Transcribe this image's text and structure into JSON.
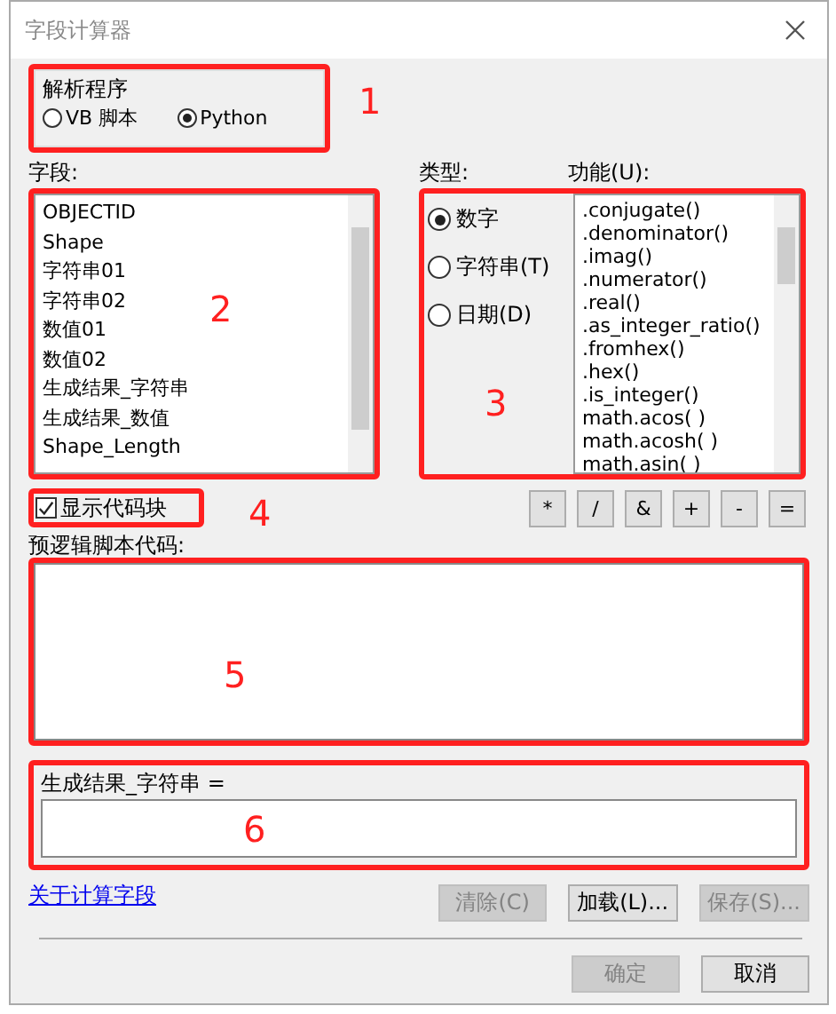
{
  "window": {
    "title": "字段计算器"
  },
  "parser": {
    "label": "解析程序",
    "options": [
      {
        "label": "VB 脚本",
        "selected": false
      },
      {
        "label": "Python",
        "selected": true
      }
    ]
  },
  "fields": {
    "label": "字段:",
    "items": [
      "OBJECTID",
      "Shape",
      "字符串01",
      "字符串02",
      "数值01",
      "数值02",
      "生成结果_字符串",
      "生成结果_数值",
      "Shape_Length"
    ]
  },
  "type": {
    "label": "类型:",
    "options": [
      {
        "label": "数字",
        "selected": true
      },
      {
        "label": "字符串(T)",
        "selected": false
      },
      {
        "label": "日期(D)",
        "selected": false
      }
    ]
  },
  "functions": {
    "label": "功能(U):",
    "items": [
      ".conjugate()",
      ".denominator()",
      ".imag()",
      ".numerator()",
      ".real()",
      ".as_integer_ratio()",
      ".fromhex()",
      ".hex()",
      ".is_integer()",
      "math.acos( )",
      "math.acosh( )",
      "math.asin( )"
    ]
  },
  "show_codeblock": {
    "label": "显示代码块",
    "checked": true
  },
  "operators": [
    "*",
    "/",
    "&",
    "+",
    "-",
    "="
  ],
  "pre_logic": {
    "label": "预逻辑脚本代码:"
  },
  "expression": {
    "label": "生成结果_字符串 ="
  },
  "help_link": "关于计算字段",
  "buttons": [
    {
      "label": "清除(C)",
      "disabled": true
    },
    {
      "label": "加载(L)...",
      "disabled": false
    },
    {
      "label": "保存(S)...",
      "disabled": true
    }
  ],
  "dialog_buttons": [
    {
      "label": "确定",
      "disabled": true
    },
    {
      "label": "取消",
      "disabled": false
    }
  ],
  "annotations": [
    "1",
    "2",
    "3",
    "4",
    "5",
    "6"
  ]
}
